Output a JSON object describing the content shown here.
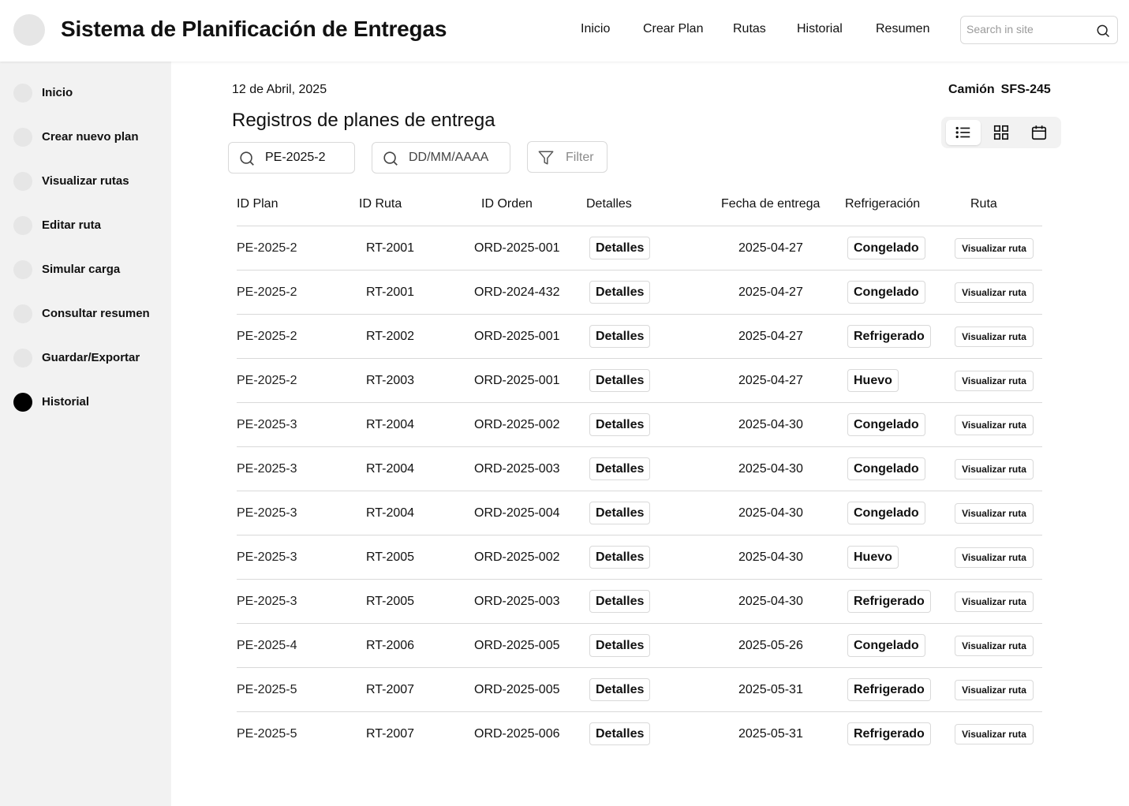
{
  "app": {
    "title": "Sistema de Planificación de Entregas"
  },
  "topnav": [
    "Inicio",
    "Crear Plan",
    "Rutas",
    "Historial",
    "Resumen"
  ],
  "search": {
    "placeholder": "Search in site",
    "icon": "search-icon"
  },
  "sidebar": {
    "items": [
      {
        "label": "Inicio",
        "active": false
      },
      {
        "label": "Crear nuevo plan",
        "active": false
      },
      {
        "label": "Visualizar rutas",
        "active": false
      },
      {
        "label": "Editar ruta",
        "active": false
      },
      {
        "label": "Simular carga",
        "active": false
      },
      {
        "label": "Consultar resumen",
        "active": false
      },
      {
        "label": "Guardar/Exportar",
        "active": false
      },
      {
        "label": "Historial",
        "active": true
      }
    ]
  },
  "main": {
    "date": "12 de Abril, 2025",
    "truck_label": "Camión",
    "truck_id": "SFS-245",
    "title": "Registros de planes de entrega",
    "plan_filter_value": "PE-2025-2",
    "date_filter_placeholder": "DD/MM/AAAA",
    "filter_label": "Filter",
    "view_modes": [
      "list-view-icon",
      "grid-view-icon",
      "calendar-view-icon"
    ],
    "active_view": "list-view-icon"
  },
  "table": {
    "headers": [
      "ID Plan",
      "ID Ruta",
      "ID Orden",
      "Detalles",
      "Fecha de entrega",
      "Refrigeración",
      "Ruta"
    ],
    "details_label": "Detalles",
    "route_label": "Visualizar ruta",
    "rows": [
      {
        "plan": "PE-2025-2",
        "ruta": "RT-2001",
        "orden": "ORD-2025-001",
        "fecha": "2025-04-27",
        "refri": "Congelado"
      },
      {
        "plan": "PE-2025-2",
        "ruta": "RT-2001",
        "orden": "ORD-2024-432",
        "fecha": "2025-04-27",
        "refri": "Congelado"
      },
      {
        "plan": "PE-2025-2",
        "ruta": "RT-2002",
        "orden": "ORD-2025-001",
        "fecha": "2025-04-27",
        "refri": "Refrigerado"
      },
      {
        "plan": "PE-2025-2",
        "ruta": "RT-2003",
        "orden": "ORD-2025-001",
        "fecha": "2025-04-27",
        "refri": "Huevo"
      },
      {
        "plan": "PE-2025-3",
        "ruta": "RT-2004",
        "orden": "ORD-2025-002",
        "fecha": "2025-04-30",
        "refri": "Congelado"
      },
      {
        "plan": "PE-2025-3",
        "ruta": "RT-2004",
        "orden": "ORD-2025-003",
        "fecha": "2025-04-30",
        "refri": "Congelado"
      },
      {
        "plan": "PE-2025-3",
        "ruta": "RT-2004",
        "orden": "ORD-2025-004",
        "fecha": "2025-04-30",
        "refri": "Congelado"
      },
      {
        "plan": "PE-2025-3",
        "ruta": "RT-2005",
        "orden": "ORD-2025-002",
        "fecha": "2025-04-30",
        "refri": "Huevo"
      },
      {
        "plan": "PE-2025-3",
        "ruta": "RT-2005",
        "orden": "ORD-2025-003",
        "fecha": "2025-04-30",
        "refri": "Refrigerado"
      },
      {
        "plan": "PE-2025-4",
        "ruta": "RT-2006",
        "orden": "ORD-2025-005",
        "fecha": "2025-05-26",
        "refri": "Congelado"
      },
      {
        "plan": "PE-2025-5",
        "ruta": "RT-2007",
        "orden": "ORD-2025-005",
        "fecha": "2025-05-31",
        "refri": "Refrigerado"
      },
      {
        "plan": "PE-2025-5",
        "ruta": "RT-2007",
        "orden": "ORD-2025-006",
        "fecha": "2025-05-31",
        "refri": "Refrigerado"
      }
    ]
  }
}
